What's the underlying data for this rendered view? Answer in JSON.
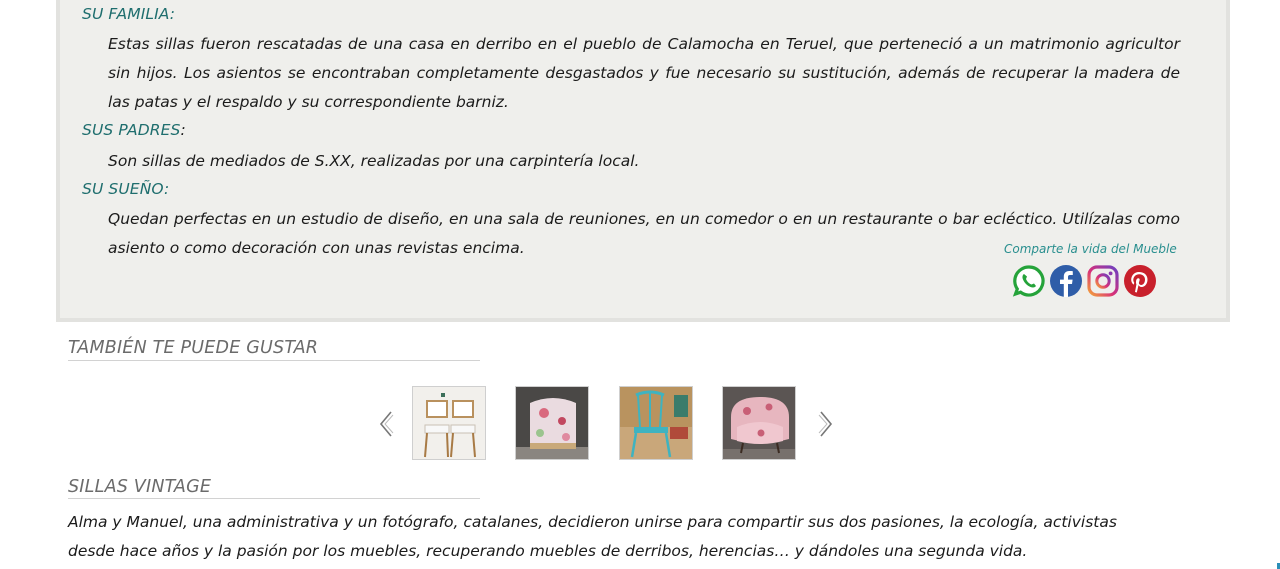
{
  "product_story": {
    "family": {
      "heading": "SU FAMILIA:",
      "text": "Estas sillas fueron rescatadas de una casa en derribo en el pueblo de Calamocha en Teruel, que perteneció a un matrimonio agricultor sin hijos. Los asientos se encontraban completamente desgastados y fue necesario su sustitución, además de recuperar la madera de las patas y el respaldo y su correspondiente barniz."
    },
    "parents": {
      "heading": "SUS PADRES",
      "colon": ":",
      "text": "Son sillas de mediados de S.XX, realizadas por una carpintería local."
    },
    "dream": {
      "heading": "SU SUEÑO:",
      "text": "Quedan perfectas en un estudio de diseño, en una sala de reuniones, en un comedor o en un restaurante o bar ecléctico. Utilízalas como asiento o como decoración con unas revistas encima."
    }
  },
  "share": {
    "label": "Comparte la vida del  Mueble",
    "icons": [
      "whatsapp-icon",
      "facebook-icon",
      "instagram-icon",
      "pinterest-icon"
    ],
    "colors": {
      "whatsapp": "#25a33a",
      "facebook": "#2f5da8",
      "pinterest": "#c8202c",
      "instagram": "#b0357f"
    }
  },
  "related": {
    "title": "TAMBIÉN TE PUEDE GUSTAR",
    "prev_icon": "chevron-left-icon",
    "next_icon": "chevron-right-icon",
    "items": [
      {
        "name": "white-chairs-thumbnail"
      },
      {
        "name": "floral-armchair-thumbnail"
      },
      {
        "name": "turquoise-chair-thumbnail"
      },
      {
        "name": "pink-armchair-thumbnail"
      }
    ]
  },
  "brand": {
    "title": "SILLAS VINTAGE",
    "text": "Alma y Manuel, una administrativa y un fotógrafo, catalanes, decidieron unirse para compartir sus dos pasiones, la ecología, activistas desde hace años y la pasión por los muebles, recuperando muebles de derribos, herencias… y dándoles una segunda vida."
  },
  "colors": {
    "accent": "#1f6e6e",
    "panel_bg": "#efefec",
    "panel_border": "#e2e2df",
    "section_title": "#6b6b6b"
  }
}
